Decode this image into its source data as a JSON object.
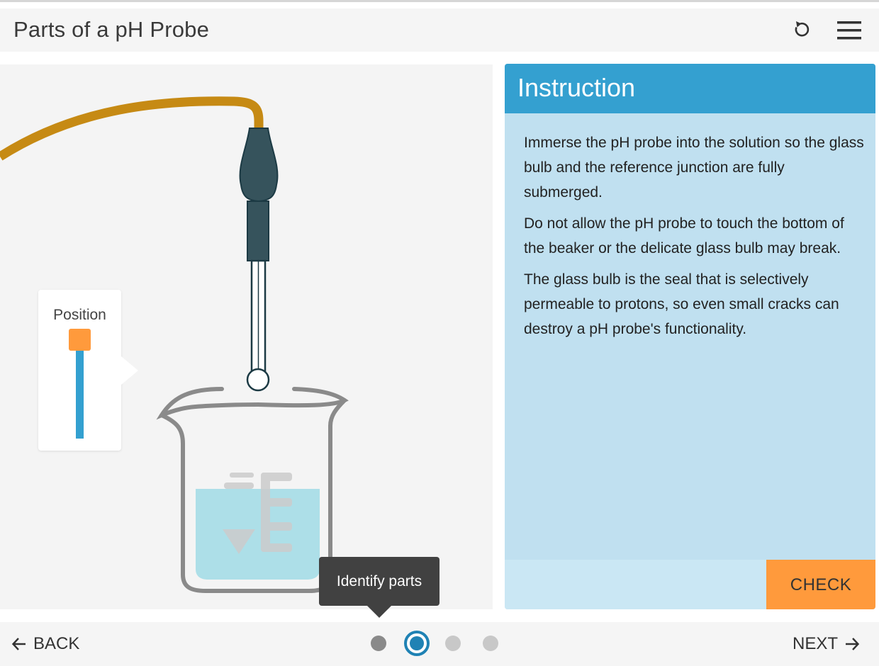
{
  "header": {
    "title": "Parts of a pH Probe",
    "reset_icon": "reset-icon",
    "menu_icon": "menu-icon"
  },
  "simulation": {
    "position_label": "Position",
    "slider_level": 1.0,
    "tooltip": "Identify parts"
  },
  "instruction": {
    "title": "Instruction",
    "paragraphs": [
      "Immerse the pH probe into the solution so the glass bulb and the reference junction are fully submerged.",
      "Do not allow the pH probe to touch the bottom of the beaker or the delicate glass bulb may break.",
      "The glass bulb is the seal that is selectively permeable to protons, so even small cracks can destroy a pH probe's functionality."
    ],
    "check_label": "CHECK"
  },
  "footer": {
    "back_label": "BACK",
    "next_label": "NEXT",
    "steps": [
      "done",
      "current",
      "pending",
      "pending"
    ],
    "current_step": 2
  },
  "colors": {
    "accent_blue": "#34a0d0",
    "panel_bg": "#c0e0f0",
    "orange": "#ff9a3c",
    "cable": "#c68a14",
    "probe": "#36535c",
    "solution": "#addfe8"
  }
}
